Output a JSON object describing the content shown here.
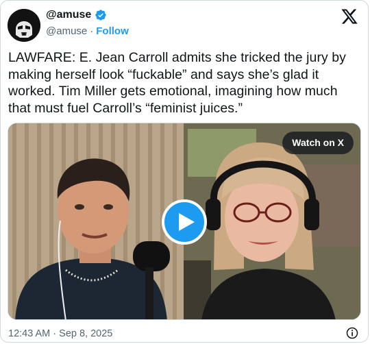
{
  "author": {
    "display_name": "@amuse",
    "handle": "@amuse",
    "separator": "·",
    "follow_label": "Follow"
  },
  "tweet": {
    "text": "LAWFARE: E. Jean Carroll admits she tricked the jury by making herself look “fuckable” and says she’s glad it worked. Tim Miller gets emotional, imagining how much that must fuel Carroll’s “feminist juices.”",
    "timestamp": "12:43 AM · Sep 8, 2025"
  },
  "media": {
    "watch_label": "Watch on X"
  },
  "colors": {
    "accent": "#1d9bf0",
    "text": "#0f1419",
    "muted": "#536471"
  },
  "icons": [
    "verified-badge-icon",
    "x-logo-icon",
    "play-icon",
    "info-icon"
  ]
}
